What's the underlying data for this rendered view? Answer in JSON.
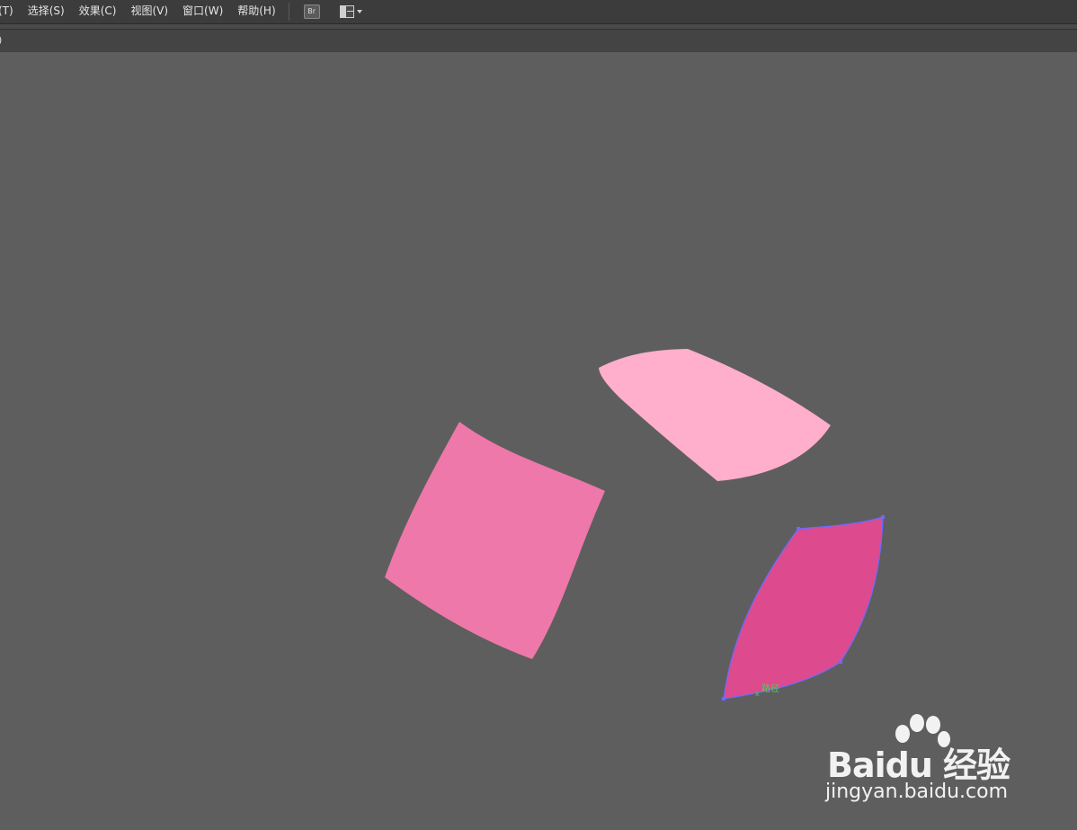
{
  "menubar": {
    "items": [
      {
        "label": "(T)"
      },
      {
        "label": "选择(S)"
      },
      {
        "label": "效果(C)"
      },
      {
        "label": "视图(V)"
      },
      {
        "label": "窗口(W)"
      },
      {
        "label": "帮助(H)"
      }
    ],
    "bridge_label": "Br",
    "workspace_icon": "workspace-layout-icon"
  },
  "document_tab": {
    "label": ")"
  },
  "canvas": {
    "background": "#5e5e5e",
    "shapes": [
      {
        "name": "pink-shape-left",
        "fill": "#ee78a9"
      },
      {
        "name": "pink-shape-top",
        "fill": "#ffaecb"
      },
      {
        "name": "pink-shape-selected",
        "fill": "#dd4a8e",
        "selected": true,
        "path_outline": "#6b6bff"
      }
    ],
    "hover_label": "路径"
  },
  "watermark": {
    "brand": "Bai",
    "brand2": "du",
    "cn": "经验",
    "url": "jingyan.baidu.com"
  }
}
